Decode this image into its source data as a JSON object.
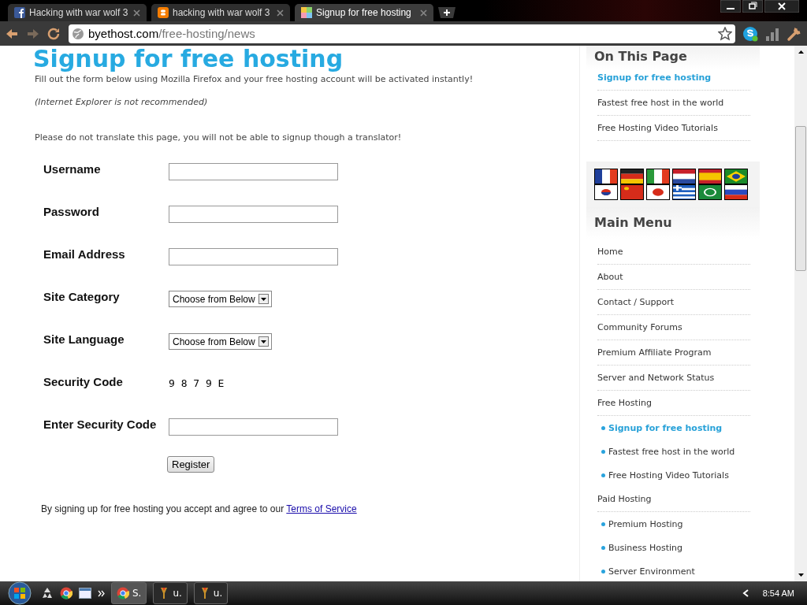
{
  "browser": {
    "tabs": [
      {
        "title": "Hacking with war wolf 3",
        "kind": "facebook",
        "selected": false
      },
      {
        "title": "hacking with war wolf 3",
        "kind": "blogger",
        "selected": false
      },
      {
        "title": "Signup for free hosting",
        "kind": "site",
        "selected": true
      }
    ],
    "address": {
      "domain": "byethost.com",
      "path": "/free-hosting/news"
    }
  },
  "page": {
    "heading": "Signup for free hosting",
    "intro": "Fill out the form below using Mozilla Firefox and your free hosting account will be activated instantly!",
    "note": "(Internet Explorer is not recommended)",
    "warning": "Please do not translate this page, you will not be able to signup though a translator!",
    "form": {
      "fields": [
        {
          "label": "Username",
          "kind": "text"
        },
        {
          "label": "Password",
          "kind": "text"
        },
        {
          "label": "Email Address",
          "kind": "text"
        },
        {
          "label": "Site Category",
          "kind": "select",
          "value": "Choose from Below"
        },
        {
          "label": "Site Language",
          "kind": "select",
          "value": "Choose from Below"
        },
        {
          "label": "Security Code",
          "kind": "code",
          "value": "9 8 7 9 E"
        },
        {
          "label": "Enter Security Code",
          "kind": "text"
        }
      ],
      "button": "Register",
      "terms": {
        "text": "By signing up for free hosting you accept and agree to our",
        "link": "Terms of Service"
      }
    }
  },
  "sidebar": {
    "on_this_page": {
      "title": "On This Page",
      "items": [
        {
          "label": "Signup for free hosting",
          "selected": true
        },
        {
          "label": "Fastest free host in the world",
          "selected": false
        },
        {
          "label": "Free Hosting Video Tutorials",
          "selected": false
        }
      ]
    },
    "main_menu": {
      "title": "Main Menu",
      "items": [
        {
          "label": "Home",
          "selected": false
        },
        {
          "label": "About",
          "selected": false
        },
        {
          "label": "Contact / Support",
          "selected": false
        },
        {
          "label": "Community Forums",
          "selected": false
        },
        {
          "label": "Premium Affiliate Program",
          "selected": false
        },
        {
          "label": "Server and Network Status",
          "selected": false
        },
        {
          "label": "Free Hosting",
          "selected": false,
          "children": [
            {
              "label": "Signup for free hosting",
              "selected": true
            },
            {
              "label": "Fastest free host in the world",
              "selected": false
            },
            {
              "label": "Free Hosting Video Tutorials",
              "selected": false
            }
          ]
        },
        {
          "label": "Paid Hosting",
          "selected": false,
          "children": [
            {
              "label": "Premium Hosting",
              "selected": false
            },
            {
              "label": "Business Hosting",
              "selected": false
            },
            {
              "label": "Server Environment",
              "selected": false
            }
          ]
        }
      ]
    }
  },
  "taskbar": {
    "items": [
      {
        "label": "S.",
        "kind": "chrome",
        "selected": true
      },
      {
        "label": "u.",
        "kind": "app",
        "selected": false
      },
      {
        "label": "u.",
        "kind": "app",
        "selected": false
      }
    ],
    "clock": "8:54 AM"
  }
}
